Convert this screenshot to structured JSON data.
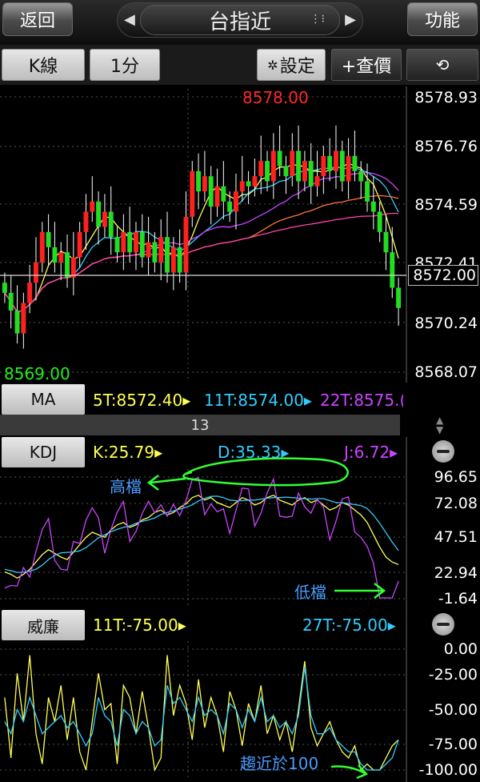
{
  "header": {
    "back_label": "返回",
    "title": "台指近",
    "function_label": "功能",
    "prev_icon": "◀",
    "next_icon": "▶"
  },
  "toolbar": {
    "chart_type": "K線",
    "interval": "1分",
    "settings_label": "設定",
    "quote_label": "+查價"
  },
  "price_chart": {
    "high_label": "8578.00",
    "low_label": "8569.00",
    "axis_ticks": [
      "8578.93",
      "8576.76",
      "8574.59",
      "8572.41",
      "8570.24",
      "8568.07"
    ],
    "current_price": "8572.00"
  },
  "ma": {
    "label": "MA",
    "ma5": "5T:8572.40",
    "ma11": "11T:8574.00",
    "ma22": "22T:8575.("
  },
  "divider_count": "13",
  "kdj": {
    "label": "KDJ",
    "k": "K:25.79",
    "d": "D:35.33",
    "j": "J:6.72",
    "axis_ticks": [
      "96.65",
      "72.08",
      "47.51",
      "22.94",
      "-1.64"
    ],
    "anno_high": "高檔",
    "anno_low": "低檔"
  },
  "williams": {
    "label": "威廉",
    "w11": "11T:-75.00",
    "w27": "27T:-75.00",
    "axis_ticks": [
      "0.00",
      "-25.00",
      "-50.00",
      "-75.00",
      "-100.00"
    ],
    "anno": "趨近於100"
  },
  "colors": {
    "up": "#ff2020",
    "down": "#22dd22",
    "ma5": "#ffff55",
    "ma11": "#33ccff",
    "ma22": "#cc44ff",
    "annotation": "#4a9cff",
    "marker": "#33ff33"
  },
  "chart_data": [
    {
      "type": "candlestick",
      "title": "",
      "ylim": [
        8568.07,
        8578.93
      ],
      "y_ticks": [
        8578.93,
        8576.76,
        8574.59,
        8572.41,
        8570.24,
        8568.07
      ],
      "high": 8578.0,
      "low": 8569.0,
      "current": 8572.0,
      "series": [
        {
          "name": "5T",
          "last": 8572.4
        },
        {
          "name": "11T",
          "last": 8574.0
        },
        {
          "name": "22T",
          "last": 8575.0
        }
      ]
    },
    {
      "type": "line",
      "ylim": [
        -1.64,
        96.65
      ],
      "y_ticks": [
        96.65,
        72.08,
        47.51,
        22.94,
        -1.64
      ],
      "series": [
        {
          "name": "K",
          "last": 25.79
        },
        {
          "name": "D",
          "last": 35.33
        },
        {
          "name": "J",
          "last": 6.72
        }
      ]
    },
    {
      "type": "line",
      "ylim": [
        -100,
        0
      ],
      "y_ticks": [
        0,
        -25,
        -50,
        -75,
        -100
      ],
      "series": [
        {
          "name": "11T",
          "last": -75.0
        },
        {
          "name": "27T",
          "last": -75.0
        }
      ]
    }
  ]
}
